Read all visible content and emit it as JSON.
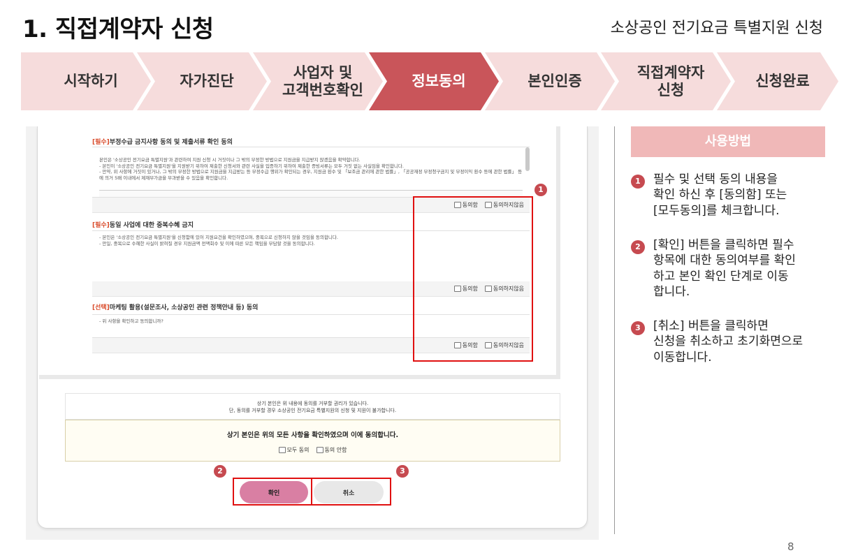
{
  "header": {
    "title": "1. 직접계약자 신청",
    "subtitle": "소상공인 전기요금 특별지원 신청"
  },
  "steps": [
    {
      "label": "시작하기",
      "active": false
    },
    {
      "label": "자가진단",
      "active": false
    },
    {
      "label": "사업자 및\n고객번호확인",
      "active": false
    },
    {
      "label": "정보동의",
      "active": true
    },
    {
      "label": "본인인증",
      "active": false
    },
    {
      "label": "직접계약자\n신청",
      "active": false
    },
    {
      "label": "신청완료",
      "active": false
    }
  ],
  "sections": [
    {
      "tag": "[필수]",
      "title": "부정수급 금지사항 동의 및 제출서류 확인 동의",
      "body": "본인은 '소상공인 전기요금 특별지원'과 관련하여 지원 신청 시 거짓이나 그 밖의 부정한 방법으로 지원금을 지급받지 않겠음을 확약합니다.\n- 본인이 '소상공인 전기요금 특별지원'을 지원받기 위하여 제출한 신청서와 관련 사실을 입증하기 위하여 제출한 증빙서류는 모두 거짓 없는 사실임을 확인합니다.\n- 만약, 위 사항에 거짓이 있거나, 그 밖의 부정한 방법으로 지원금을 지급받는 등 부정수급 행위가 확인되는 경우, 지원금 환수 및 「보조금 관리에 관한 법률」, 「공공재정 부정청구금지 및 부정이익 환수 등에 관한 법률」 등에 의거 5배 이내에서 제재부가금을 부과받을 수 있음을 확인합니다.",
      "agree": "동의함",
      "disagree": "동의하지않음"
    },
    {
      "tag": "[필수]",
      "title": "동일 사업에 대한 중복수혜 금지",
      "body": "- 본인은 '소상공인 전기요금 특별지원'을 신청함에 있어 지원요건을 확인하였으며, 중복으로 신청하지 않을 것임을 동의합니다.\n- 만일, 중복으로 수혜한 사실이 밝혀질 경우 지원금액 전액회수 및 이에 따른 모든 책임을 부담할 것을 동의합니다.",
      "agree": "동의함",
      "disagree": "동의하지않음"
    },
    {
      "tag": "[선택]",
      "title": "마케팅 활용(설문조사, 소상공인 관련 정책안내 등) 동의",
      "body": "- 위 사항을 확인하고 동의합니까?",
      "agree": "동의함",
      "disagree": "동의하지않음"
    }
  ],
  "notice": {
    "line1": "상기 본인은 위 내용에 동의를 거부할 권리가 있습니다.",
    "line2": "단, 동의를 거부할 경우 소상공인 전기요금 특별지원의 신청 및 지원이 불가합니다."
  },
  "confirm": {
    "text": "상기 본인은 위의 모든 사항을 확인하였으며 이에 동의합니다.",
    "all_agree": "모두 동의",
    "disagree": "동의 안함"
  },
  "buttons": {
    "ok": "확인",
    "cancel": "취소"
  },
  "badges": [
    "1",
    "2",
    "3"
  ],
  "help": {
    "title": "사용방법",
    "items": [
      {
        "num": "1",
        "text": "필수 및 선택 동의 내용을\n확인 하신 후 [동의함] 또는\n[모두동의]를 체크합니다."
      },
      {
        "num": "2",
        "text": "[확인] 버튼을 클릭하면 필수\n항목에 대한 동의여부를 확인\n하고 본인 확인 단계로 이동\n합니다."
      },
      {
        "num": "3",
        "text": "[취소] 버튼을 클릭하면\n신청을 취소하고 초기화면으로\n이동합니다."
      }
    ]
  },
  "page_number": "8",
  "colors": {
    "active_step": "#c9555a",
    "step": "#f6dcdc",
    "highlight": "#e01010",
    "ok_button": "#d97fa3"
  }
}
